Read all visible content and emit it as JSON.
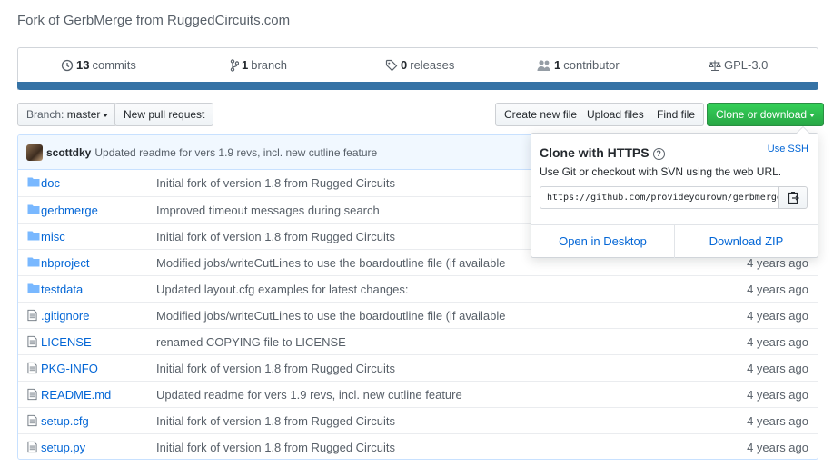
{
  "repo": {
    "description": "Fork of GerbMerge from RuggedCircuits.com"
  },
  "summary": {
    "commits_count": "13",
    "commits_label": "commits",
    "branches_count": "1",
    "branches_label": "branch",
    "releases_count": "0",
    "releases_label": "releases",
    "contributors_count": "1",
    "contributors_label": "contributor",
    "license": "GPL-3.0",
    "language_color": "#3572a5"
  },
  "toolbar": {
    "branch_prefix": "Branch:",
    "branch_name": "master",
    "new_pull_request": "New pull request",
    "create_new_file": "Create new file",
    "upload_files": "Upload files",
    "find_file": "Find file",
    "clone_or_download": "Clone or download"
  },
  "latest_commit": {
    "author": "scottdky",
    "message": "Updated readme for vers 1.9 revs, incl. new cutline feature"
  },
  "files": [
    {
      "type": "dir",
      "name": "doc",
      "message": "Initial fork of version 1.8 from Rugged Circuits",
      "age": ""
    },
    {
      "type": "dir",
      "name": "gerbmerge",
      "message": "Improved timeout messages during search",
      "age": ""
    },
    {
      "type": "dir",
      "name": "misc",
      "message": "Initial fork of version 1.8 from Rugged Circuits",
      "age": ""
    },
    {
      "type": "dir",
      "name": "nbproject",
      "message": "Modified jobs/writeCutLines to use the boardoutline file (if available",
      "age": "4 years ago"
    },
    {
      "type": "dir",
      "name": "testdata",
      "message": "Updated layout.cfg examples for latest changes:",
      "age": "4 years ago"
    },
    {
      "type": "file",
      "name": ".gitignore",
      "message": "Modified jobs/writeCutLines to use the boardoutline file (if available",
      "age": "4 years ago"
    },
    {
      "type": "file",
      "name": "LICENSE",
      "message": "renamed COPYING file to LICENSE",
      "age": "4 years ago"
    },
    {
      "type": "file",
      "name": "PKG-INFO",
      "message": "Initial fork of version 1.8 from Rugged Circuits",
      "age": "4 years ago"
    },
    {
      "type": "file",
      "name": "README.md",
      "message": "Updated readme for vers 1.9 revs, incl. new cutline feature",
      "age": "4 years ago"
    },
    {
      "type": "file",
      "name": "setup.cfg",
      "message": "Initial fork of version 1.8 from Rugged Circuits",
      "age": "4 years ago"
    },
    {
      "type": "file",
      "name": "setup.py",
      "message": "Initial fork of version 1.8 from Rugged Circuits",
      "age": "4 years ago"
    }
  ],
  "clone_popover": {
    "title": "Clone with HTTPS",
    "help_glyph": "?",
    "use_ssh": "Use SSH",
    "subtitle": "Use Git or checkout with SVN using the web URL.",
    "url": "https://github.com/provideyourown/gerbmerge.git",
    "open_desktop": "Open in Desktop",
    "download_zip": "Download ZIP"
  }
}
